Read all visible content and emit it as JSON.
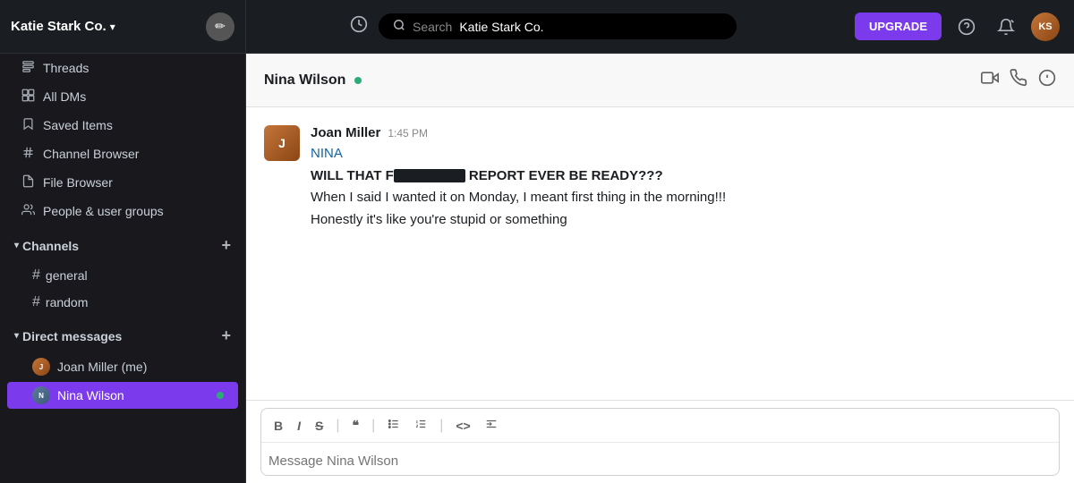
{
  "topbar": {
    "workspace": "Katie Stark Co.",
    "search_placeholder": "Search",
    "search_query": "Katie Stark Co.",
    "upgrade_label": "UPGRADE",
    "edit_icon": "✏",
    "history_icon": "🕐",
    "help_icon": "?",
    "notification_icon": "🔔"
  },
  "sidebar": {
    "nav_items": [
      {
        "id": "threads",
        "icon": "☰",
        "label": "Threads"
      },
      {
        "id": "all-dms",
        "icon": "⊞",
        "label": "All DMs"
      },
      {
        "id": "saved-items",
        "icon": "🔖",
        "label": "Saved Items"
      },
      {
        "id": "channel-browser",
        "icon": "#",
        "label": "Channel Browser"
      },
      {
        "id": "file-browser",
        "icon": "📄",
        "label": "File Browser"
      },
      {
        "id": "people-groups",
        "icon": "👥",
        "label": "People & user groups"
      }
    ],
    "channels_section": "Channels",
    "channels": [
      {
        "id": "general",
        "name": "general"
      },
      {
        "id": "random",
        "name": "random"
      }
    ],
    "dm_section": "Direct messages",
    "dms": [
      {
        "id": "joan-miller",
        "name": "Joan Miller (me)",
        "active": false
      },
      {
        "id": "nina-wilson",
        "name": "Nina Wilson",
        "active": true
      }
    ]
  },
  "chat": {
    "contact_name": "Nina Wilson",
    "messages": [
      {
        "id": "msg1",
        "sender": "Joan Miller",
        "time": "1:45 PM",
        "lines": [
          {
            "type": "mention",
            "text": "NINA"
          },
          {
            "type": "angry",
            "text": "WILL THAT F_______ REPORT EVER BE READY???"
          },
          {
            "type": "normal",
            "text": "When I said I wanted it on Monday, I meant first thing in the morning!!!"
          },
          {
            "type": "normal",
            "text": "Honestly it's like you're stupid or something"
          }
        ]
      }
    ],
    "composer_placeholder": "Message Nina Wilson",
    "toolbar_buttons": [
      "B",
      "I",
      "S",
      "\"\"",
      "≡",
      "≡",
      "<>",
      "≡"
    ],
    "bold": "B",
    "italic": "I",
    "strikethrough": "S",
    "quote": "❝",
    "bullet_list": "≡",
    "numbered_list": "≡",
    "code": "<>",
    "indent": "≡"
  }
}
